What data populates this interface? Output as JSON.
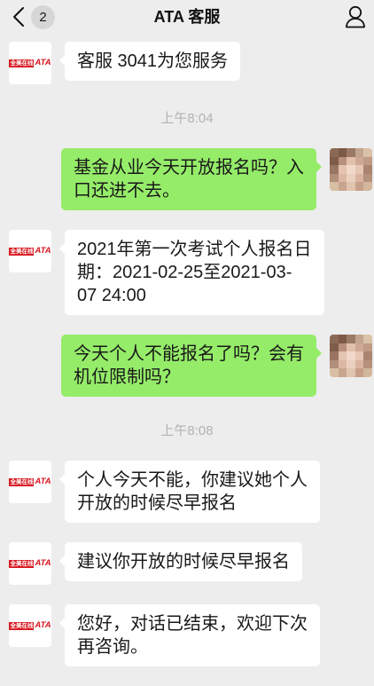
{
  "header": {
    "unread_count": "2",
    "title": "ATA 客服"
  },
  "icons": {
    "back": "chevron-left-icon",
    "profile": "person-icon"
  },
  "colors": {
    "background": "#ededed",
    "sent_bubble": "#95ec69",
    "received_bubble": "#ffffff",
    "timestamp_text": "#b2b2b2",
    "message_text": "#191919",
    "logo_red": "#d7161e",
    "badge": "#d6d6d6"
  },
  "agent_avatar": {
    "logo_cn": "全美在线",
    "logo_en": "ATA"
  },
  "user_avatar": {
    "mosaic_colors": [
      "#8b6a55",
      "#7d5a47",
      "#9a7a64",
      "#c2a58f",
      "#d9c2a6",
      "#7e5c49",
      "#b88f7a",
      "#e2c0ac",
      "#cfa893",
      "#bf9a84",
      "#9a7562",
      "#e4c3b1",
      "#f1d8c9",
      "#e6c6b4",
      "#a98470",
      "#b28f7b",
      "#dcb7a3",
      "#ecd0bf",
      "#d9b39f",
      "#b6917c",
      "#d8bfa3",
      "#c9a58f",
      "#e0c4ae",
      "#c79f89",
      "#d3b79c"
    ]
  },
  "messages": [
    {
      "received": [
        "客服 3041为您服务"
      ]
    },
    {
      "time": "上午8:04"
    },
    {
      "sent": [
        "基金从业今天开放报名吗？入",
        "口还进不去。"
      ]
    },
    {
      "received": [
        "2021年第一次考试个人报名日",
        "期：2021-02-25至2021-03-",
        "07 24:00"
      ]
    },
    {
      "sent": [
        "今天个人不能报名了吗？会有",
        "机位限制吗？"
      ]
    },
    {
      "time": "上午8:08"
    },
    {
      "received": [
        "个人今天不能，你建议她个人",
        "开放的时候尽早报名"
      ]
    },
    {
      "received": [
        "建议你开放的时候尽早报名"
      ]
    },
    {
      "received": [
        "您好，对话已结束，欢迎下次",
        "再咨询。"
      ]
    }
  ]
}
